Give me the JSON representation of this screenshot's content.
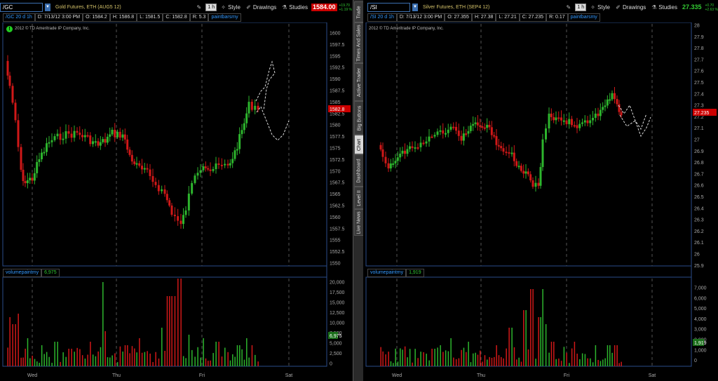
{
  "colors": {
    "up": "#2db52d",
    "down": "#d01818",
    "grid": "#555555",
    "axis": "#aaaaaa",
    "sidebar": "#2a2a2a"
  },
  "left": {
    "symbol": "/GC",
    "description": "Gold Futures, ETH (AUG5 12)",
    "aggregation": "1 h",
    "style_label": "Style",
    "drawings_label": "Drawings",
    "studies_label": "Studies",
    "last_price": "1584.00",
    "net_change": "+19.70",
    "pct_change": "+1.19 %",
    "info": {
      "sym": "/GC 20 d 1h",
      "date": "D: 7/13/12 3:00 PM",
      "open": "O: 1584.2",
      "high": "H: 1586.8",
      "low": "L: 1581.5",
      "close": "C: 1582.8",
      "range": "R: 5.3",
      "study": "paintbarsmy"
    },
    "copyright": "2012 © TD Ameritrade IP Company, Inc.",
    "price_axis": [
      "1600",
      "1597.5",
      "1595",
      "1592.5",
      "1590",
      "1587.5",
      "1585",
      "1582.5",
      "1580",
      "1577.5",
      "1575",
      "1572.5",
      "1570",
      "1567.5",
      "1565",
      "1562.5",
      "1560",
      "1557.5",
      "1555",
      "1552.5",
      "1550"
    ],
    "price_tag": "1582.8",
    "volume_study": "volumepaintmy",
    "volume_value": "6,975",
    "volume_tag": "6,975",
    "volume_axis": [
      "20,000",
      "17,500",
      "15,000",
      "12,500",
      "10,000",
      "7,500",
      "5,000",
      "2,500",
      "0"
    ],
    "days": [
      "Wed",
      "Thu",
      "Fri",
      "Sat"
    ]
  },
  "right": {
    "symbol": "/SI",
    "description": "Silver Futures, ETH (SEP4 12)",
    "aggregation": "1 h",
    "style_label": "Style",
    "drawings_label": "Drawings",
    "studies_label": "Studies",
    "last_price": "27.335",
    "net_change": "+0.70",
    "pct_change": "+2.63 %",
    "info": {
      "sym": "/SI 20 d 1h",
      "date": "D: 7/13/12 3:00 PM",
      "open": "O: 27.355",
      "high": "H: 27.38",
      "low": "L: 27.21",
      "close": "C: 27.235",
      "range": "R: 0.17",
      "study": "paintbarsmy"
    },
    "copyright": "2012 © TD Ameritrade IP Company, Inc.",
    "price_axis": [
      "28",
      "27.9",
      "27.8",
      "27.7",
      "27.6",
      "27.5",
      "27.4",
      "27.3",
      "27.2",
      "27.1",
      "27",
      "26.9",
      "26.8",
      "26.7",
      "26.6",
      "26.5",
      "26.4",
      "26.3",
      "26.2",
      "26.1",
      "26",
      "25.9"
    ],
    "price_tag": "27.235",
    "volume_study": "volumepaintmy",
    "volume_value": "1,919",
    "volume_tag": "1,919",
    "volume_axis": [
      "7,000",
      "6,000",
      "5,000",
      "4,000",
      "3,000",
      "2,000",
      "1,000",
      "0"
    ],
    "days": [
      "Wed",
      "Thu",
      "Fri",
      "Sat"
    ]
  },
  "sidebar_tabs": [
    "Trade",
    "Times And Sales",
    "Active Trader",
    "Big Buttons",
    "Chart",
    "Dashboard",
    "Level II",
    "Live News"
  ],
  "chart_data": [
    {
      "type": "candlestick",
      "title": "/GC 20 d 1h",
      "ylim": [
        1549,
        1602
      ],
      "x_ticks": [
        "Wed",
        "Thu",
        "Fri",
        "Sat"
      ],
      "up_closes": [
        1574,
        1578,
        1580,
        1577,
        1573,
        1571,
        1568,
        1562,
        1572,
        1570,
        1573,
        1580,
        1585
      ],
      "last": 1582.8,
      "volume_ylim": [
        0,
        20000
      ],
      "volume_last": 6975
    },
    {
      "type": "candlestick",
      "title": "/SI 20 d 1h",
      "ylim": [
        25.9,
        28
      ],
      "x_ticks": [
        "Wed",
        "Thu",
        "Fri",
        "Sat"
      ],
      "last": 27.235,
      "volume_ylim": [
        0,
        7000
      ],
      "volume_last": 1919
    }
  ]
}
